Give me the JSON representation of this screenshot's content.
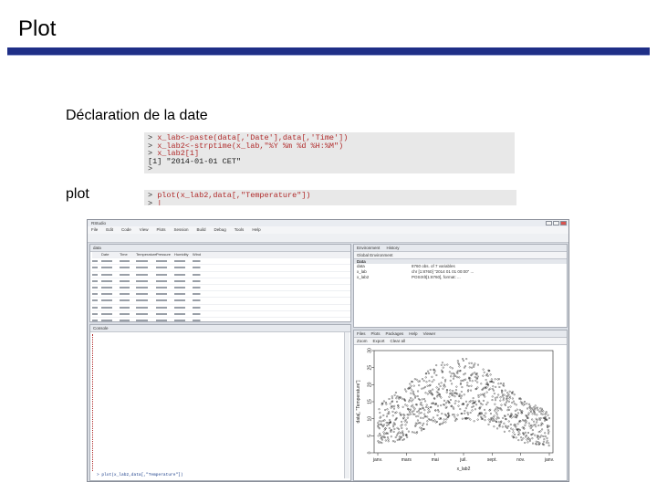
{
  "slide": {
    "title": "Plot",
    "label1": "Déclaration de la date",
    "label2": "plot"
  },
  "code1": {
    "lines": [
      {
        "prompt": "> ",
        "text": "x_lab<-paste(data[,'Date'],data[,'Time'])"
      },
      {
        "prompt": "> ",
        "text": "x_lab2<-strptime(x_lab,\"%Y %m %d %H:%M\")"
      },
      {
        "prompt": "> ",
        "text": "x_lab2[1]"
      },
      {
        "prompt": "",
        "text": "[1] \"2014-01-01 CET\""
      },
      {
        "prompt": "> ",
        "text": ""
      }
    ]
  },
  "code2": {
    "lines": [
      {
        "prompt": "> ",
        "text": "plot(x_lab2,data[,\"Temperature\"])"
      },
      {
        "prompt": "> ",
        "text": "|"
      }
    ]
  },
  "rstudio": {
    "window_title": "RStudio",
    "menu": [
      "File",
      "Edit",
      "Code",
      "View",
      "Plots",
      "Session",
      "Build",
      "Debug",
      "Tools",
      "Help"
    ],
    "data_tab": "data",
    "columns": [
      "",
      "Date",
      "Time",
      "Temperature",
      "Pressure",
      "Humidity",
      "Wind"
    ],
    "console_label": "Console",
    "console_last": "> plot(x_lab2,data[,\"Temperature\"])",
    "env_tabs": [
      "Environment",
      "History"
    ],
    "global_env": "Global Environment",
    "env_section": "Data",
    "env_rows": [
      {
        "name": "data",
        "value": "8760 obs. of 7 variables"
      },
      {
        "name": "x_lab",
        "value": "chr [1:8760] \"2014 01 01 00:00\" ..."
      },
      {
        "name": "x_lab2",
        "value": "POSIXlt[1:8760], format: ..."
      }
    ],
    "plot_tabs": [
      "Files",
      "Plots",
      "Packages",
      "Help",
      "Viewer"
    ],
    "plot_tools": [
      "Zoom",
      "Export",
      "Clear all"
    ],
    "plot_ylabel": "data[, \"Temperature\"]",
    "plot_xlabel": "x_lab2",
    "x_ticks": [
      "janv.",
      "mars",
      "mai",
      "juil.",
      "sept.",
      "nov.",
      "janv."
    ],
    "y_ticks": [
      "0",
      "5",
      "10",
      "15",
      "20",
      "25",
      "30"
    ]
  },
  "chart_data": {
    "type": "scatter",
    "title": "",
    "xlabel": "x_lab2",
    "ylabel": "data[, \"Temperature\"]",
    "x_categories": [
      "janv.",
      "mars",
      "mai",
      "juil.",
      "sept.",
      "nov.",
      "janv."
    ],
    "ylim": [
      0,
      30
    ],
    "series": [
      {
        "values": [
          {
            "x": "janv.",
            "y_range": [
              2,
              14
            ]
          },
          {
            "x": "mars",
            "y_range": [
              4,
              20
            ]
          },
          {
            "x": "mai",
            "y_range": [
              8,
              26
            ]
          },
          {
            "x": "juil.",
            "y_range": [
              10,
              28
            ]
          },
          {
            "x": "sept.",
            "y_range": [
              8,
              24
            ]
          },
          {
            "x": "nov.",
            "y_range": [
              3,
              16
            ]
          },
          {
            "x": "janv.",
            "y_range": [
              2,
              12
            ]
          }
        ]
      }
    ]
  }
}
